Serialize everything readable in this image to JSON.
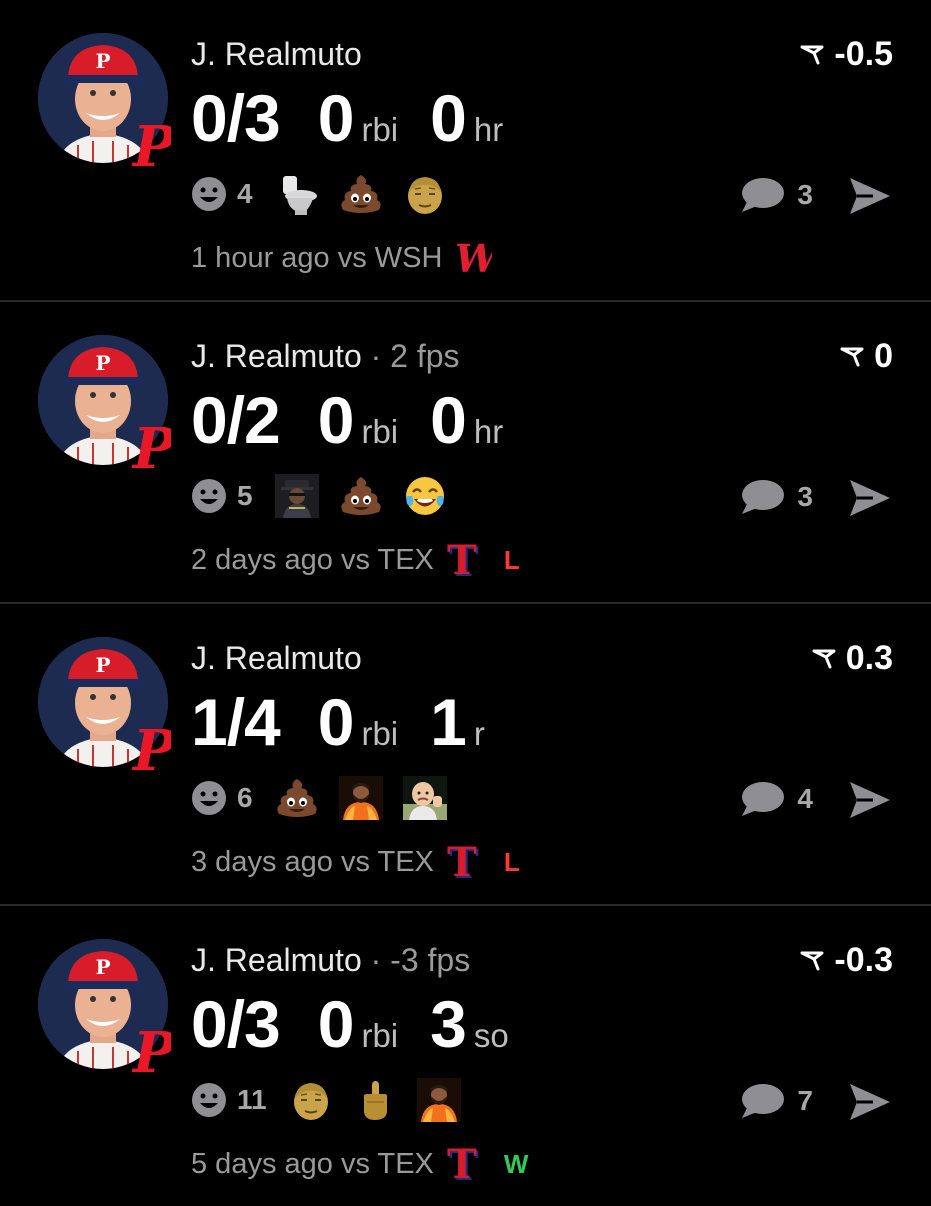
{
  "feed": [
    {
      "player": "J. Realmuto",
      "fps": "",
      "delta": "-0.5",
      "stats": [
        {
          "value": "0/3",
          "unit": ""
        },
        {
          "value": "0",
          "unit": "rbi"
        },
        {
          "value": "0",
          "unit": "hr"
        }
      ],
      "reaction_count": "4",
      "emojis": [
        "toilet",
        "poop",
        "old-man-face"
      ],
      "comments": "3",
      "time": "1 hour ago vs WSH",
      "opponent_logo": "nationals-logo",
      "result": ""
    },
    {
      "player": "J. Realmuto",
      "fps": " · 2 fps",
      "delta": "0",
      "stats": [
        {
          "value": "0/2",
          "unit": ""
        },
        {
          "value": "0",
          "unit": "rbi"
        },
        {
          "value": "0",
          "unit": "hr"
        }
      ],
      "reaction_count": "5",
      "emojis": [
        "rapper-gif",
        "poop",
        "tears-of-joy"
      ],
      "comments": "3",
      "time": "2 days ago vs TEX",
      "opponent_logo": "rangers-logo",
      "result": "L"
    },
    {
      "player": "J. Realmuto",
      "fps": "",
      "delta": "0.3",
      "stats": [
        {
          "value": "1/4",
          "unit": ""
        },
        {
          "value": "0",
          "unit": "rbi"
        },
        {
          "value": "1",
          "unit": "r"
        }
      ],
      "reaction_count": "6",
      "emojis": [
        "poop",
        "drake-gif",
        "success-kid-gif"
      ],
      "comments": "4",
      "time": "3 days ago vs TEX",
      "opponent_logo": "rangers-logo",
      "result": "L"
    },
    {
      "player": "J. Realmuto",
      "fps": " · -3 fps",
      "delta": "-0.3",
      "stats": [
        {
          "value": "0/3",
          "unit": ""
        },
        {
          "value": "0",
          "unit": "rbi"
        },
        {
          "value": "3",
          "unit": "so"
        }
      ],
      "reaction_count": "11",
      "emojis": [
        "old-man-face",
        "middle-finger",
        "drake-gif"
      ],
      "comments": "7",
      "time": "5 days ago vs TEX",
      "opponent_logo": "rangers-logo",
      "result": "W"
    }
  ],
  "colors": {
    "loss": "#ff3b30",
    "win": "#34c759",
    "phillies_red": "#e81828",
    "muted": "#9a9a9a"
  }
}
